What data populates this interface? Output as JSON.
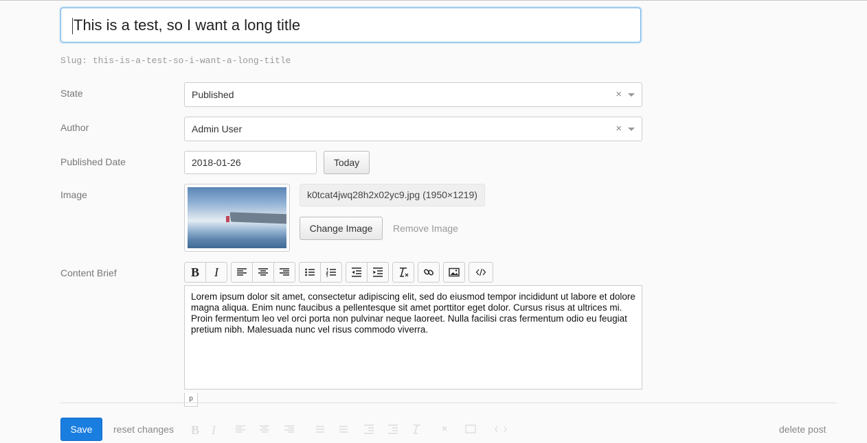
{
  "title": {
    "value": "This is a test, so I want a long title"
  },
  "slug": {
    "label": "Slug:",
    "value": "this-is-a-test-so-i-want-a-long-title"
  },
  "fields": {
    "state": {
      "label": "State",
      "value": "Published",
      "clear": "×"
    },
    "author": {
      "label": "Author",
      "value": "Admin User",
      "clear": "×"
    },
    "published_date": {
      "label": "Published Date",
      "value": "2018-01-26",
      "today_label": "Today"
    },
    "image": {
      "label": "Image",
      "file_info": "k0tcat4jwq28h2x02yc9.jpg (1950×1219)",
      "change_label": "Change Image",
      "remove_label": "Remove Image"
    },
    "content_brief": {
      "label": "Content Brief",
      "text": "Lorem ipsum dolor sit amet, consectetur adipiscing elit, sed do eiusmod tempor incididunt ut labore et dolore magna aliqua. Enim nunc faucibus a pellentesque sit amet porttitor eget dolor. Cursus risus at ultrices mi. Proin fermentum leo vel orci porta non pulvinar neque laoreet. Nulla facilisi cras fermentum odio eu feugiat pretium nibh. Malesuada nunc vel risus commodo viverra.",
      "path_tag": "p"
    }
  },
  "toolbar": {
    "bold": "B",
    "italic": "I",
    "icons": [
      "bold-icon",
      "italic-icon",
      "align-left-icon",
      "align-center-icon",
      "align-right-icon",
      "bullet-list-icon",
      "numbered-list-icon",
      "outdent-icon",
      "indent-icon",
      "clear-format-icon",
      "link-icon",
      "image-icon",
      "code-icon"
    ]
  },
  "footer": {
    "save_label": "Save",
    "reset_label": "reset changes",
    "delete_label": "delete post"
  },
  "colors": {
    "accent": "#1a7ee0",
    "focus_border": "#66afe9"
  }
}
